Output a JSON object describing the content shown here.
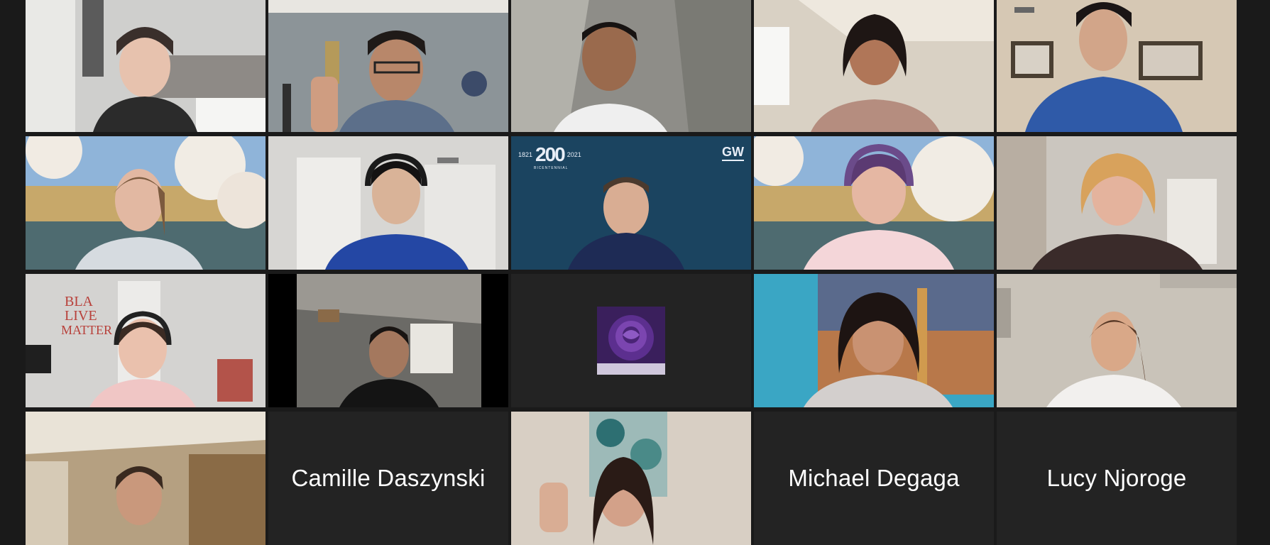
{
  "meeting": {
    "view": "Gallery View"
  },
  "tiles": [
    {
      "type": "video",
      "scene": "living-room-headset"
    },
    {
      "type": "video",
      "scene": "thumbs-up-room"
    },
    {
      "type": "video",
      "scene": "plain-wall-smile"
    },
    {
      "type": "video",
      "scene": "bright-room-smile"
    },
    {
      "type": "video",
      "scene": "framed-pictures-room"
    },
    {
      "type": "video",
      "scene": "cherry-blossom-campus",
      "active_speaker": true
    },
    {
      "type": "video",
      "scene": "closet-headset"
    },
    {
      "type": "video",
      "scene": "gw-bicentennial-background",
      "overlay": {
        "years_left": "1821",
        "mark": "200",
        "years_right": "2021",
        "subtitle": "BICENTENNIAL",
        "logo": "GW"
      }
    },
    {
      "type": "video",
      "scene": "cherry-blossom-headphones"
    },
    {
      "type": "video",
      "scene": "home-interior-glasses"
    },
    {
      "type": "video",
      "scene": "blm-poster-room"
    },
    {
      "type": "video",
      "scene": "dim-room-window"
    },
    {
      "type": "avatar",
      "scene": "purple-rose-avatar"
    },
    {
      "type": "video",
      "scene": "city-bridge-poster"
    },
    {
      "type": "video",
      "scene": "neutral-wall"
    },
    {
      "type": "video",
      "scene": "kitchen-cabinets"
    },
    {
      "type": "name",
      "name": "Camille Daszynski"
    },
    {
      "type": "video",
      "scene": "thumbs-up-floral-wall"
    },
    {
      "type": "name",
      "name": "Michael Degaga"
    },
    {
      "type": "name",
      "name": "Lucy Njoroge"
    }
  ],
  "colors": {
    "background": "#1a1a1a",
    "tile": "#232323",
    "active_border": "#d7e26b",
    "name_text": "#ffffff"
  }
}
